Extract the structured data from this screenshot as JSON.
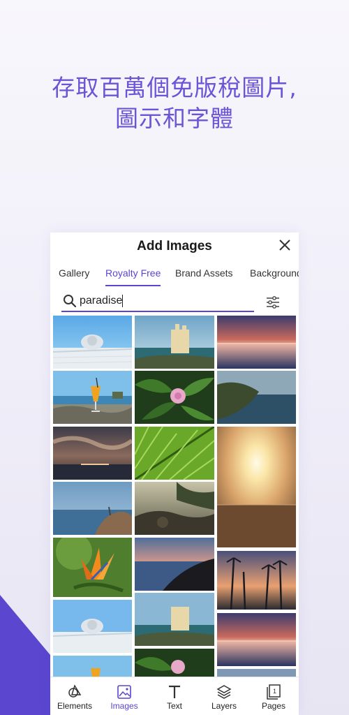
{
  "headline": {
    "line1": "存取百萬個免版稅圖片,",
    "line2": "圖示和字體"
  },
  "dialog": {
    "title": "Add Images",
    "close_icon": "close-icon"
  },
  "tabs": [
    {
      "label": "Gallery",
      "active": false
    },
    {
      "label": "Royalty Free",
      "active": true
    },
    {
      "label": "Brand Assets",
      "active": false
    },
    {
      "label": "Backgrounds",
      "active": false
    }
  ],
  "search": {
    "value": "paradise",
    "icon": "search-icon",
    "filter_icon": "sliders-icon"
  },
  "images": [
    {
      "subject": "infinity pool with sun hat"
    },
    {
      "subject": "seaside castle hotel"
    },
    {
      "subject": "sunset over ocean horizon"
    },
    {
      "subject": "cocktail on tropical beach"
    },
    {
      "subject": "green leaves with pink flower"
    },
    {
      "subject": "rocky coastline"
    },
    {
      "subject": "stormy sunset over sea"
    },
    {
      "subject": "palm frond close-up"
    },
    {
      "subject": "sun over desert"
    },
    {
      "subject": "rocks by blue sea"
    },
    {
      "subject": "rocky shore at dusk"
    },
    {
      "subject": "bird of paradise flower"
    },
    {
      "subject": "beach sunset waves"
    },
    {
      "subject": "palm trees silhouette sunset"
    },
    {
      "subject": "infinity pool with sun hat"
    },
    {
      "subject": "seaside castle hotel"
    },
    {
      "subject": "sunset over ocean horizon"
    },
    {
      "subject": "cocktail on tropical beach"
    },
    {
      "subject": "green leaves with pink flower"
    },
    {
      "subject": "ocean view"
    }
  ],
  "bottom_nav": [
    {
      "label": "Elements",
      "icon": "shapes-icon",
      "active": false
    },
    {
      "label": "Images",
      "icon": "image-icon",
      "active": true
    },
    {
      "label": "Text",
      "icon": "text-icon",
      "active": false
    },
    {
      "label": "Layers",
      "icon": "layers-icon",
      "active": false
    },
    {
      "label": "Pages",
      "icon": "pages-icon",
      "active": false,
      "badge": "1"
    }
  ],
  "colors": {
    "accent": "#5a46cf",
    "headline": "#6b54d6"
  }
}
